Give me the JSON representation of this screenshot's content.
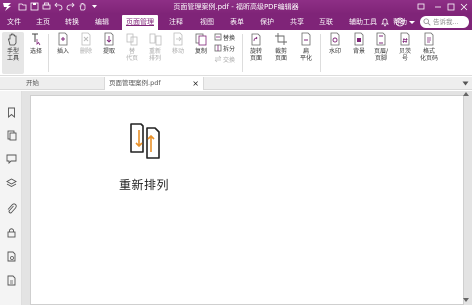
{
  "window": {
    "title": "页面管理案例.pdf - 福昕高级PDF编辑器",
    "accent_color": "#7f2478"
  },
  "menu": {
    "items": [
      {
        "label": "文件"
      },
      {
        "label": "主页"
      },
      {
        "label": "转换"
      },
      {
        "label": "编辑"
      },
      {
        "label": "页面管理"
      },
      {
        "label": "注释"
      },
      {
        "label": "视图"
      },
      {
        "label": "表单"
      },
      {
        "label": "保护"
      },
      {
        "label": "共享"
      },
      {
        "label": "互联"
      },
      {
        "label": "辅助工具"
      },
      {
        "label": "帮助"
      }
    ],
    "active": "页面管理",
    "search_placeholder": "告诉我..."
  },
  "toolbar": {
    "hand": "手型\n工具",
    "select": "选择",
    "insert": "插入",
    "delete": "删除",
    "extract": "提取",
    "replace_page": "替\n代页",
    "reorder": "重新\n排列",
    "move": "移动",
    "copy": "复制",
    "replace": "替换",
    "split": "拆分",
    "swap": "交换",
    "rotate": "旋转\n页面",
    "crop": "裁剪\n页面",
    "flatten": "扁\n平化",
    "watermark": "水印",
    "background": "背景",
    "header_footer": "页眉/\n页脚",
    "bates": "贝茨\n号",
    "format_page_numbers": "格式\n化页码"
  },
  "tabs": [
    {
      "label": "开始"
    },
    {
      "label": "页面管理案例.pdf",
      "close": "×"
    }
  ],
  "sidebar": {
    "icons": [
      "bookmark-icon",
      "pages-icon",
      "comment-icon",
      "layers-icon",
      "attachment-icon",
      "security-icon",
      "file-info-icon",
      "tag-icon"
    ]
  },
  "document": {
    "caption": "重新排列"
  }
}
